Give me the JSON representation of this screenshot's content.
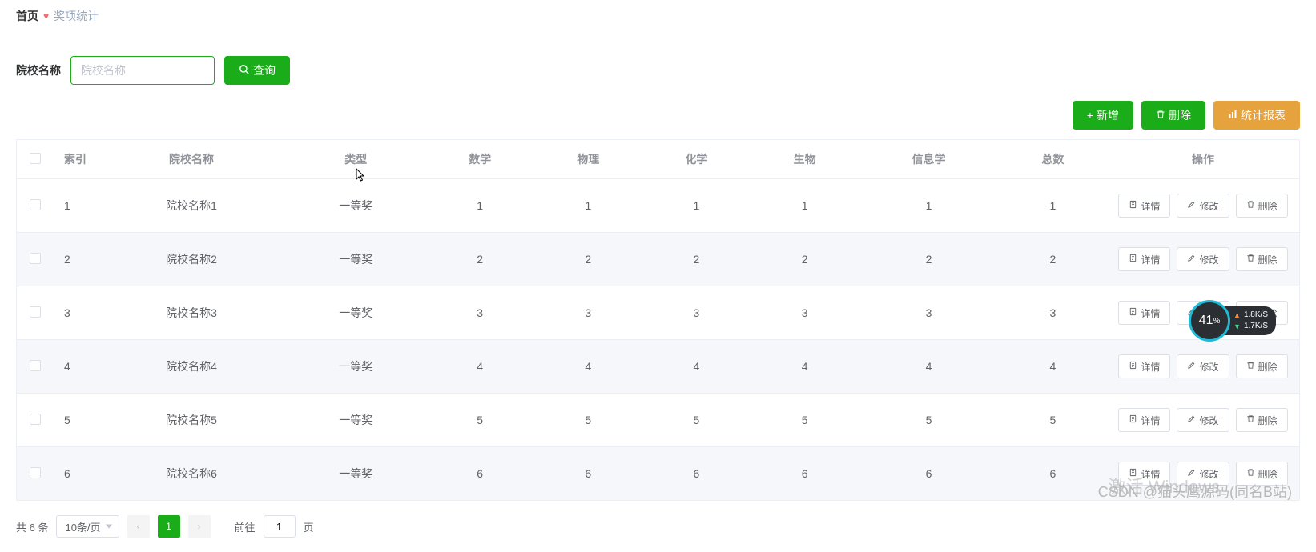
{
  "breadcrumb": {
    "home": "首页",
    "current": "奖项统计"
  },
  "search": {
    "label": "院校名称",
    "placeholder": "院校名称",
    "buttonLabel": "查询"
  },
  "actions": {
    "add": "新增",
    "delete": "删除",
    "report": "统计报表"
  },
  "table": {
    "headers": {
      "index": "索引",
      "school": "院校名称",
      "type": "类型",
      "math": "数学",
      "physics": "物理",
      "chemistry": "化学",
      "biology": "生物",
      "informatics": "信息学",
      "total": "总数",
      "ops": "操作"
    },
    "opsLabels": {
      "detail": "详情",
      "edit": "修改",
      "delete": "删除"
    },
    "rows": [
      {
        "index": "1",
        "school": "院校名称1",
        "type": "一等奖",
        "math": "1",
        "physics": "1",
        "chemistry": "1",
        "biology": "1",
        "informatics": "1",
        "total": "1"
      },
      {
        "index": "2",
        "school": "院校名称2",
        "type": "一等奖",
        "math": "2",
        "physics": "2",
        "chemistry": "2",
        "biology": "2",
        "informatics": "2",
        "total": "2"
      },
      {
        "index": "3",
        "school": "院校名称3",
        "type": "一等奖",
        "math": "3",
        "physics": "3",
        "chemistry": "3",
        "biology": "3",
        "informatics": "3",
        "total": "3"
      },
      {
        "index": "4",
        "school": "院校名称4",
        "type": "一等奖",
        "math": "4",
        "physics": "4",
        "chemistry": "4",
        "biology": "4",
        "informatics": "4",
        "total": "4"
      },
      {
        "index": "5",
        "school": "院校名称5",
        "type": "一等奖",
        "math": "5",
        "physics": "5",
        "chemistry": "5",
        "biology": "5",
        "informatics": "5",
        "total": "5"
      },
      {
        "index": "6",
        "school": "院校名称6",
        "type": "一等奖",
        "math": "6",
        "physics": "6",
        "chemistry": "6",
        "biology": "6",
        "informatics": "6",
        "total": "6"
      }
    ]
  },
  "pagination": {
    "total": "共 6 条",
    "pageSize": "10条/页",
    "current": "1",
    "jumpPrefix": "前往",
    "jumpValue": "1",
    "jumpSuffix": "页"
  },
  "watermark": {
    "csdn": "CSDN @猫头鹰源码(同名B站)",
    "windows": "激活 Windows"
  },
  "netWidget": {
    "percent": "41",
    "percentUnit": "%",
    "up": "1.8K/S",
    "down": "1.7K/S"
  }
}
